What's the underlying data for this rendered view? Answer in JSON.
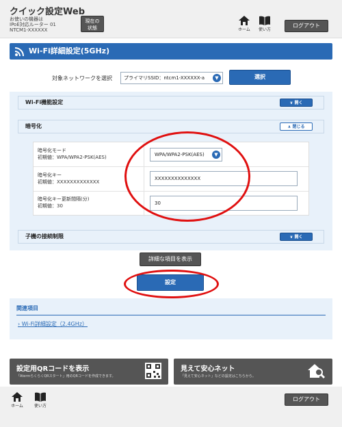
{
  "header": {
    "brand": "クイック設定Web",
    "device_line1": "お使いの機器は",
    "device_line2": "IPoE対応ルーター 01",
    "device_line3": "NTCM1-XXXXXX",
    "status_line1": "現在の",
    "status_line2": "状態",
    "home_label": "ホーム",
    "howto_label": "使い方",
    "logout_label": "ログアウト"
  },
  "title": "Wi-Fi詳細設定(5GHz)",
  "network": {
    "label": "対象ネットワークを選択",
    "selected": "プライマリSSID：ntcm1-XXXXXX-a",
    "select_button": "選択"
  },
  "sections": {
    "wifi_function": {
      "label": "Wi-Fi機能設定",
      "toggle": "開く"
    },
    "encryption": {
      "label": "暗号化",
      "toggle": "閉じる"
    },
    "child_limit": {
      "label": "子機の接続制限",
      "toggle": "開く"
    }
  },
  "encryption": {
    "mode_label": "暗号化モード",
    "mode_default": "初期値：WPA/WPA2-PSK(AES)",
    "mode_value": "WPA/WPA2-PSK(AES)",
    "key_label": "暗号化キー",
    "key_default": "初期値：XXXXXXXXXXXXX",
    "key_value": "XXXXXXXXXXXXXX",
    "interval_label": "暗号化キー更新間隔(分)",
    "interval_default": "初期値：30",
    "interval_value": "30"
  },
  "buttons": {
    "show_details": "詳細な項目を表示",
    "apply": "設定"
  },
  "related": {
    "title": "関連項目",
    "link": "Wi-Fi詳細設定（2.4GHz）"
  },
  "banners": {
    "qr_title": "設定用QRコードを表示",
    "qr_sub": "「AtermらくらくQRスタート」用のQRコードを作成できます。",
    "safe_title": "見えて安心ネット",
    "safe_sub": "「見えて安心ネット」などの設定はこちらから。"
  },
  "footer": {
    "home_label": "ホーム",
    "howto_label": "使い方",
    "logout_label": "ログアウト"
  },
  "colors": {
    "accent": "#2a6ab5",
    "panel": "#e8f1fa",
    "dark_button": "#555555",
    "annotation": "#e01010"
  }
}
